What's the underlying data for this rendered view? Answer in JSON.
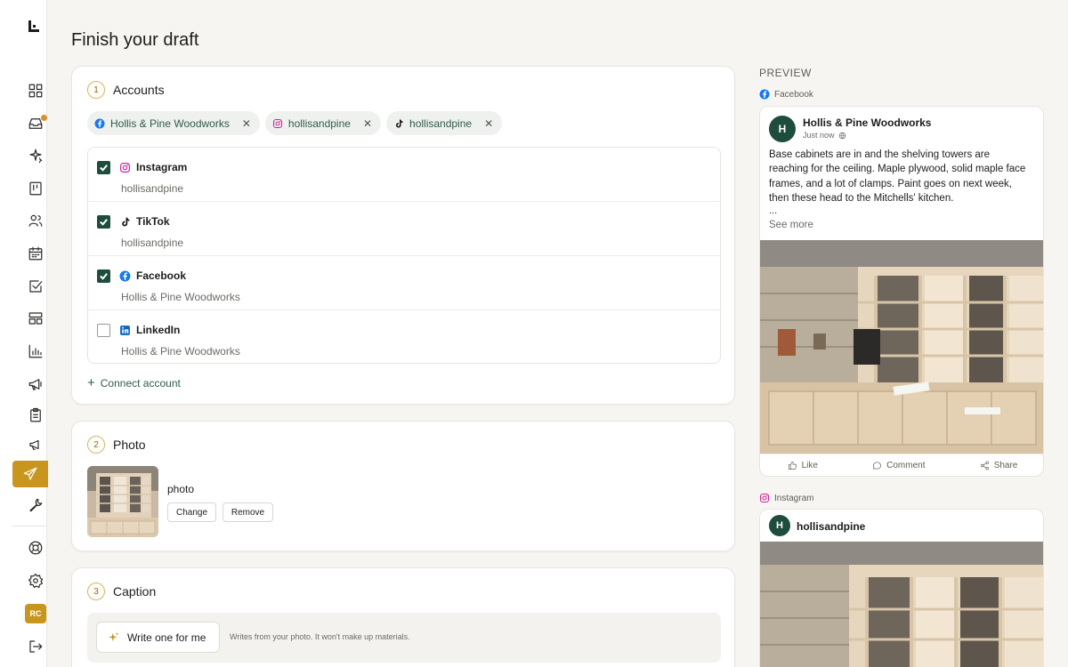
{
  "page": {
    "title": "Finish your draft"
  },
  "sidebar": {
    "icons": [
      "logo-icon",
      "dashboard-icon",
      "inbox-icon",
      "sparkle-icon",
      "board-icon",
      "people-icon",
      "calendar-icon",
      "check-square-icon",
      "layout-icon",
      "chart-icon",
      "megaphone-icon",
      "clipboard-icon",
      "megaphone-small-icon",
      "send-icon",
      "wrench-icon",
      "help-icon",
      "gear-icon",
      "logout-icon"
    ],
    "active": "send-icon",
    "avatar_initials": "RC",
    "accent": "#c8961e"
  },
  "accounts": {
    "step": "1",
    "title": "Accounts",
    "chips": [
      {
        "platform": "facebook",
        "label": "Hollis & Pine Woodworks"
      },
      {
        "platform": "instagram",
        "label": "hollisandpine"
      },
      {
        "platform": "tiktok",
        "label": "hollisandpine"
      }
    ],
    "list": [
      {
        "platform": "Instagram",
        "handle": "hollisandpine",
        "checked": true
      },
      {
        "platform": "TikTok",
        "handle": "hollisandpine",
        "checked": true
      },
      {
        "platform": "Facebook",
        "handle": "Hollis & Pine Woodworks",
        "checked": true
      },
      {
        "platform": "LinkedIn",
        "handle": "Hollis & Pine Woodworks",
        "checked": false
      }
    ],
    "connect_label": "Connect account"
  },
  "photo": {
    "step": "2",
    "title": "Photo",
    "file_label": "photo",
    "change_label": "Change",
    "remove_label": "Remove"
  },
  "caption": {
    "step": "3",
    "title": "Caption",
    "write_label": "Write one for me",
    "hint": "Writes from your photo. It won't make up materials."
  },
  "preview": {
    "label": "PREVIEW",
    "facebook": {
      "tag": "Facebook",
      "initial": "H",
      "name": "Hollis & Pine Woodworks",
      "time": "Just now",
      "body": "Base cabinets are in and the shelving towers are reaching for the ceiling. Maple plywood, solid maple face frames, and a lot of clamps. Paint goes on next week, then these head to the Mitchells' kitchen.",
      "ellipsis": "...",
      "see_more": "See more",
      "like": "Like",
      "comment": "Comment",
      "share": "Share"
    },
    "instagram": {
      "tag": "Instagram",
      "initial": "H",
      "name": "hollisandpine"
    }
  },
  "colors": {
    "brand_green": "#1f4d3d",
    "accent_gold": "#c8961e",
    "link_green": "#2f5d4a"
  }
}
